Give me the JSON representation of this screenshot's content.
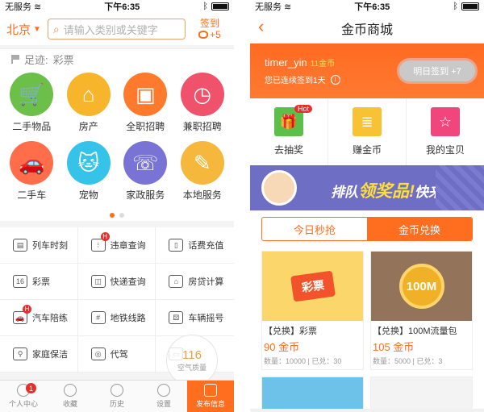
{
  "status": {
    "carrier": "无服务",
    "time": "下午6:35"
  },
  "left": {
    "city": "北京",
    "search_placeholder": "请输入类别或关键字",
    "signin_label": "签到",
    "signin_bonus": "+5",
    "footprint_label": "足迹:",
    "footprint_value": "彩票",
    "categories": [
      {
        "label": "二手物品",
        "icon": "shopping-cart-icon",
        "color": "#6cc04a"
      },
      {
        "label": "房产",
        "icon": "house-icon",
        "color": "#f7b52c"
      },
      {
        "label": "全职招聘",
        "icon": "id-card-icon",
        "color": "#ff7a2c"
      },
      {
        "label": "兼职招聘",
        "icon": "person-clock-icon",
        "color": "#f0516b"
      },
      {
        "label": "二手车",
        "icon": "car-icon",
        "color": "#ff6d4a"
      },
      {
        "label": "宠物",
        "icon": "cat-icon",
        "color": "#36c3e9"
      },
      {
        "label": "家政服务",
        "icon": "phone-icon",
        "color": "#7a73d6"
      },
      {
        "label": "本地服务",
        "icon": "compass-icon",
        "color": "#f5b83d"
      }
    ],
    "services": [
      {
        "label": "列车时刻",
        "icon": "train-icon",
        "badge": ""
      },
      {
        "label": "违章查询",
        "icon": "traffic-light-icon",
        "badge": "H"
      },
      {
        "label": "话费充值",
        "icon": "mobile-icon",
        "badge": ""
      },
      {
        "label": "彩票",
        "icon": "lottery-icon",
        "badge": ""
      },
      {
        "label": "快递查询",
        "icon": "package-icon",
        "badge": ""
      },
      {
        "label": "房贷计算",
        "icon": "house-calc-icon",
        "badge": ""
      },
      {
        "label": "汽车陪练",
        "icon": "car-icon",
        "badge": "H"
      },
      {
        "label": "地铁线路",
        "icon": "subway-icon",
        "badge": ""
      },
      {
        "label": "车辆摇号",
        "icon": "dice-icon",
        "badge": ""
      },
      {
        "label": "家庭保洁",
        "icon": "broom-icon",
        "badge": ""
      },
      {
        "label": "代驾",
        "icon": "steering-wheel-icon",
        "badge": ""
      },
      {
        "label": "",
        "icon": "truck-icon",
        "badge": ""
      }
    ],
    "speed_value": "116",
    "speed_label": "空气质量",
    "tabs": [
      {
        "label": "个人中心",
        "badge": "1"
      },
      {
        "label": "收藏",
        "badge": ""
      },
      {
        "label": "历史",
        "badge": ""
      },
      {
        "label": "设置",
        "badge": ""
      },
      {
        "label": "发布信息",
        "badge": ""
      }
    ]
  },
  "right": {
    "title": "金币商城",
    "username": "timer_yin",
    "coins": "11金币",
    "streak": "您已连续签到1天",
    "tomorrow_button": "明日签到 +7",
    "entries": [
      {
        "label": "去抽奖",
        "color": "#5bbf4a",
        "badge": "Hot"
      },
      {
        "label": "赚金币",
        "color": "#f7c233",
        "badge": ""
      },
      {
        "label": "我的宝贝",
        "color": "#f0457d",
        "badge": ""
      }
    ],
    "banner_prefix": "排队",
    "banner_big": "领奖品!",
    "banner_suffix": "快来呀!",
    "segments": [
      "今日秒抢",
      "金币兑换"
    ],
    "products": [
      {
        "image_text": "彩票",
        "title": "【兑换】彩票",
        "price": "90 金币",
        "meta": "数量：10000 | 已兑：30"
      },
      {
        "image_text": "100M",
        "title": "【兑换】100M流量包",
        "price": "105 金币",
        "meta": "数量：5000 | 已兑：3"
      }
    ]
  }
}
